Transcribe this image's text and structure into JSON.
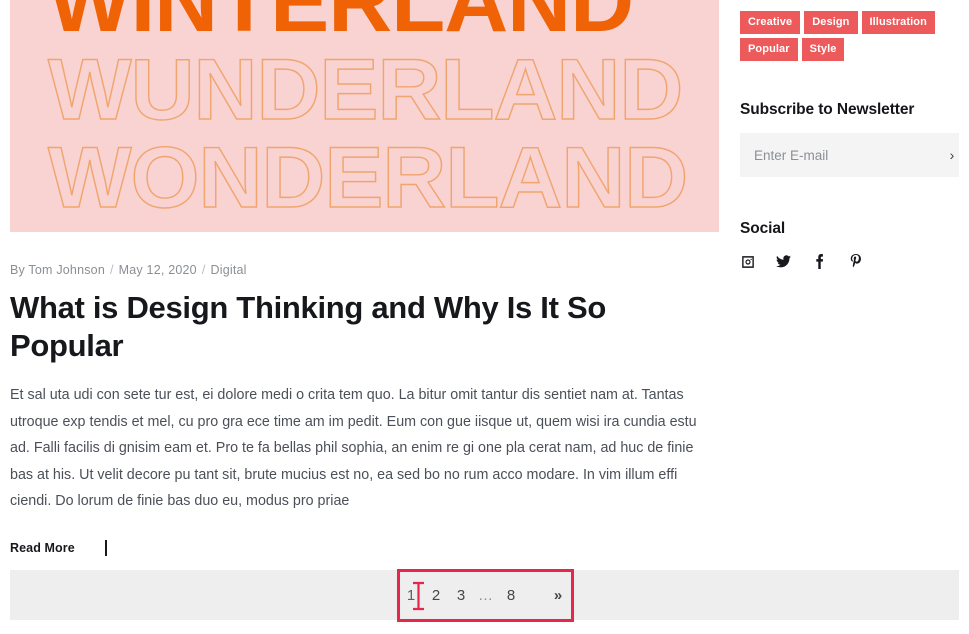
{
  "hero": {
    "line1": "WINTERLAND",
    "line2": "WUNDERLAND",
    "line3": "WONDERLAND",
    "bg_color": "#f9d2d2",
    "filled_text_color": "#ef6306",
    "outline_text_color": "#f0a56e"
  },
  "post": {
    "byline_prefix": "By Tom Johnson",
    "date": "May 12, 2020",
    "category": "Digital",
    "separator": "/",
    "title": "What is Design Thinking and Why Is It So Popular",
    "excerpt": "Et sal uta udi con sete tur est, ei dolore medi o crita tem quo. La bitur omit tantur dis sentiet nam at. Tantas utroque exp tendis et mel, cu pro gra ece time am im pedit. Eum con gue iisque ut, quem wisi ira cundia estu ad. Falli facilis di gnisim eam et. Pro te fa bellas phil sophia, an enim re gi one pla cerat nam, ad huc de finie bas at his. Ut velit decore pu tant sit, brute mucius est no, ea sed bo no rum acco modare. In vim illum effi ciendi. Do lorum de finie bas duo eu, modus pro priae",
    "read_more": "Read More"
  },
  "sidebar": {
    "tags": [
      {
        "label": "Creative"
      },
      {
        "label": "Design"
      },
      {
        "label": "Illustration"
      },
      {
        "label": "Popular"
      },
      {
        "label": "Style"
      }
    ],
    "tag_color": "#ec5a5b",
    "newsletter": {
      "title": "Subscribe to Newsletter",
      "placeholder": "Enter E-mail",
      "value": "",
      "submit_glyph": "›"
    },
    "social": {
      "title": "Social",
      "icons": [
        {
          "name": "instagram-icon"
        },
        {
          "name": "twitter-icon"
        },
        {
          "name": "facebook-icon"
        },
        {
          "name": "pinterest-icon"
        }
      ]
    }
  },
  "pagination": {
    "items": [
      {
        "label": "1",
        "type": "current"
      },
      {
        "label": "2",
        "type": "page"
      },
      {
        "label": "3",
        "type": "page"
      },
      {
        "label": "…",
        "type": "dots"
      },
      {
        "label": "8",
        "type": "page"
      }
    ],
    "next_label": "»",
    "bar_color": "#eeeeee"
  },
  "overlay": {
    "highlight_color": "#e8254a",
    "caret_color": "#e8254a"
  }
}
